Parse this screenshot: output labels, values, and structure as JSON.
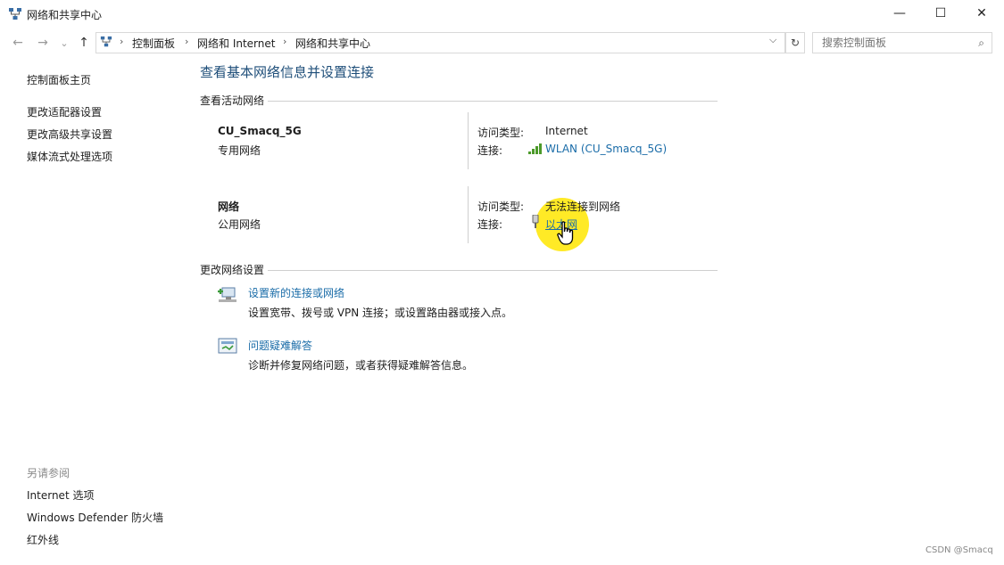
{
  "window": {
    "title": "网络和共享中心",
    "minimize": "—",
    "maximize": "☐",
    "close": "✕"
  },
  "nav": {
    "back": "←",
    "forward": "→",
    "recent": "⌄",
    "up": "↑",
    "breadcrumbs": [
      "控制面板",
      "网络和 Internet",
      "网络和共享中心"
    ],
    "dropdown": "⌵",
    "refresh": "↻",
    "search_placeholder": "搜索控制面板",
    "search_icon": "⌕"
  },
  "sidebar": {
    "home": "控制面板主页",
    "items": [
      "更改适配器设置",
      "更改高级共享设置",
      "媒体流式处理选项"
    ],
    "see_also_title": "另请参阅",
    "see_also": [
      "Internet 选项",
      "Windows Defender 防火墙",
      "红外线"
    ]
  },
  "main": {
    "title": "查看基本网络信息并设置连接",
    "active_section": "查看活动网络",
    "networks": [
      {
        "name": "CU_Smacq_5G",
        "type": "专用网络",
        "access_label": "访问类型:",
        "access_value": "Internet",
        "conn_label": "连接:",
        "conn_value": "WLAN (CU_Smacq_5G)"
      },
      {
        "name": "网络",
        "type": "公用网络",
        "access_label": "访问类型:",
        "access_value": "无法连接到网络",
        "conn_label": "连接:",
        "conn_value": "以太网"
      }
    ],
    "change_section": "更改网络设置",
    "tasks": [
      {
        "title": "设置新的连接或网络",
        "desc": "设置宽带、拨号或 VPN 连接；或设置路由器或接入点。"
      },
      {
        "title": "问题疑难解答",
        "desc": "诊断并修复网络问题，或者获得疑难解答信息。"
      }
    ]
  },
  "watermark": "CSDN @Smacq",
  "colors": {
    "link": "#1a6ca8",
    "title": "#1e4e79",
    "highlight": "#ffe600"
  }
}
